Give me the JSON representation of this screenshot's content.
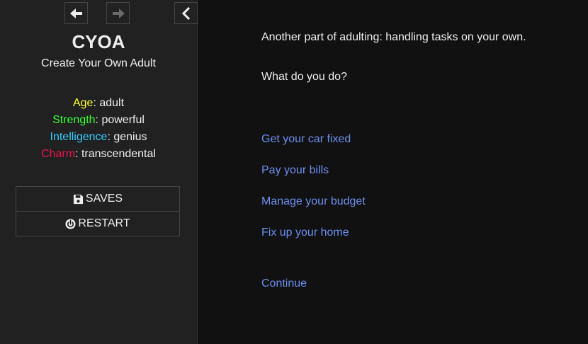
{
  "nav": {
    "back_icon": "arrow-left-icon",
    "forward_icon": "arrow-right-icon",
    "toggle_icon": "chevron-left-icon"
  },
  "story": {
    "title": "CYOA",
    "subtitle": "Create Your Own Adult"
  },
  "stats": [
    {
      "label": "Age",
      "value": "adult",
      "color": "#ffff33"
    },
    {
      "label": "Strength",
      "value": "powerful",
      "color": "#33ff33"
    },
    {
      "label": "Intelligence",
      "value": "genius",
      "color": "#33ccff"
    },
    {
      "label": "Charm",
      "value": "transcendental",
      "color": "#e8144a"
    }
  ],
  "stat_separator": ": ",
  "menu": {
    "saves_label": "SAVES",
    "saves_icon": "save-icon",
    "restart_label": "RESTART",
    "restart_icon": "power-icon"
  },
  "passage": {
    "text": "Another part of adulting: handling tasks on your own.",
    "question": "What do you do?",
    "choices": [
      "Get your car fixed",
      "Pay your bills",
      "Manage your budget",
      "Fix up your home"
    ],
    "continue_label": "Continue"
  },
  "colors": {
    "link": "#6b8ff0",
    "sidebar_bg": "#212121",
    "main_bg": "#111111",
    "text": "#eeeeee"
  }
}
